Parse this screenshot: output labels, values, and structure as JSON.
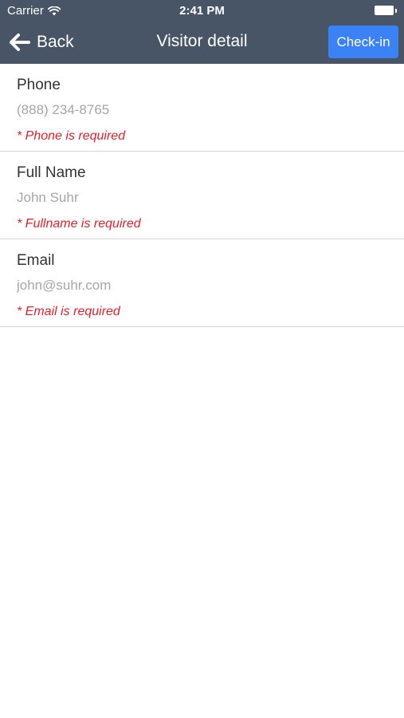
{
  "status_bar": {
    "carrier": "Carrier",
    "time": "2:41 PM",
    "icons": [
      "wifi-icon",
      "battery-icon"
    ]
  },
  "nav": {
    "back_label": "Back",
    "title": "Visitor detail",
    "action_label": "Check-in",
    "back_icon": "arrow-left-icon"
  },
  "colors": {
    "header_bg": "#475567",
    "action_button": "#3b82f6",
    "error_text": "#e8202a",
    "placeholder_text": "#a6a6a6"
  },
  "form": {
    "phone": {
      "label": "Phone",
      "value": "",
      "placeholder": "(888) 234-8765",
      "error": "* Phone is required"
    },
    "fullname": {
      "label": "Full Name",
      "value": "",
      "placeholder": "John Suhr",
      "error": "* Fullname is required"
    },
    "email": {
      "label": "Email",
      "value": "",
      "placeholder": "john@suhr.com",
      "error": "* Email is required"
    }
  }
}
